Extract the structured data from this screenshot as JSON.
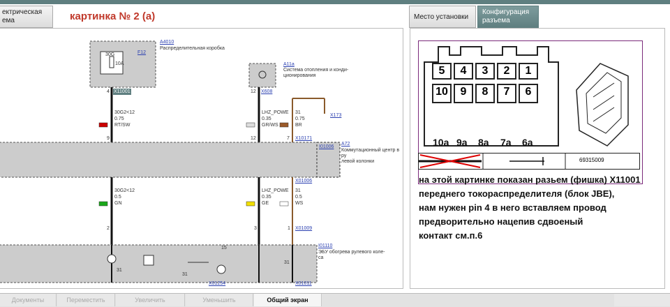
{
  "tabs": [
    {
      "label": "ектрическая\nема"
    },
    {
      "label": "Место установки"
    },
    {
      "label": "Конфигурация\nразъема"
    }
  ],
  "heading": "картинка № 2 (а)",
  "schematic": {
    "a4010_id": "A4010",
    "a4010_desc": "Распределительная коробка",
    "f12": "F12",
    "fuse_top": "30G",
    "fuse_val": "10A",
    "x11001": "X11001",
    "a11a_id": "A11a",
    "a11a_desc": "Система отопления и конди-\nционирования",
    "x608": "X608",
    "x173": "X173",
    "w1_name": "30G2<12",
    "w1_size": "0.75",
    "w1_color": "RT/SW",
    "w2_name": "LHZ_POWE",
    "w2_size": "0.35",
    "w2_color": "GR/WS",
    "w3_name": "31",
    "w3_size": "0.75",
    "w3_color": "BR",
    "x10171": "X10171",
    "a72_id": "A72",
    "a72_desc": "Коммутационный центр в ру\nлевой колонки",
    "i01006": "I01006",
    "x01006": "X01006",
    "w4_name": "30G2<12",
    "w4_size": "0.5",
    "w4_color": "GN",
    "w5_name": "LHZ_POWE",
    "w5_size": "0.35",
    "w5_color": "GE",
    "w6_name": "31",
    "w6_size": "0.5",
    "w6_color": "WS",
    "x01009": "X01009",
    "i01110": "I01110",
    "i01110_desc": "ЭБУ обогрева рулевого коле-\nса",
    "x01254": "X01254",
    "x01011": "X01011",
    "pin_4": "4",
    "pin_9": "9",
    "pin_12": "12",
    "pin_7": "7",
    "pin_2": "2",
    "pin_3": "3",
    "pin_1": "1",
    "n31a": "31",
    "n31b": "31",
    "n31c": "31",
    "n15": "15"
  },
  "connector": {
    "top_row": [
      "5",
      "4",
      "3",
      "2",
      "1"
    ],
    "mid_row": [
      "10",
      "9",
      "8",
      "7",
      "6"
    ],
    "bottom_labels": [
      "10a",
      "9a",
      "8a",
      "7a",
      "6a"
    ],
    "part_number": "69315009"
  },
  "description": [
    "на этой картинке показан разьем (фишка) X11001",
    "переднего токораспределителя (блок JBE),",
    "нам нужен pin 4 в него вставляем провод",
    "предворительно нацепив сдвоеный",
    "контакт см.п.6"
  ],
  "bottom_buttons": [
    "Документы",
    "Переместить",
    "Увеличить",
    "Уменьшить",
    "Общий экран"
  ],
  "colors": {
    "tab_active": "#5f7f80",
    "heading": "#c0392b",
    "link": "#2a3fb0"
  }
}
